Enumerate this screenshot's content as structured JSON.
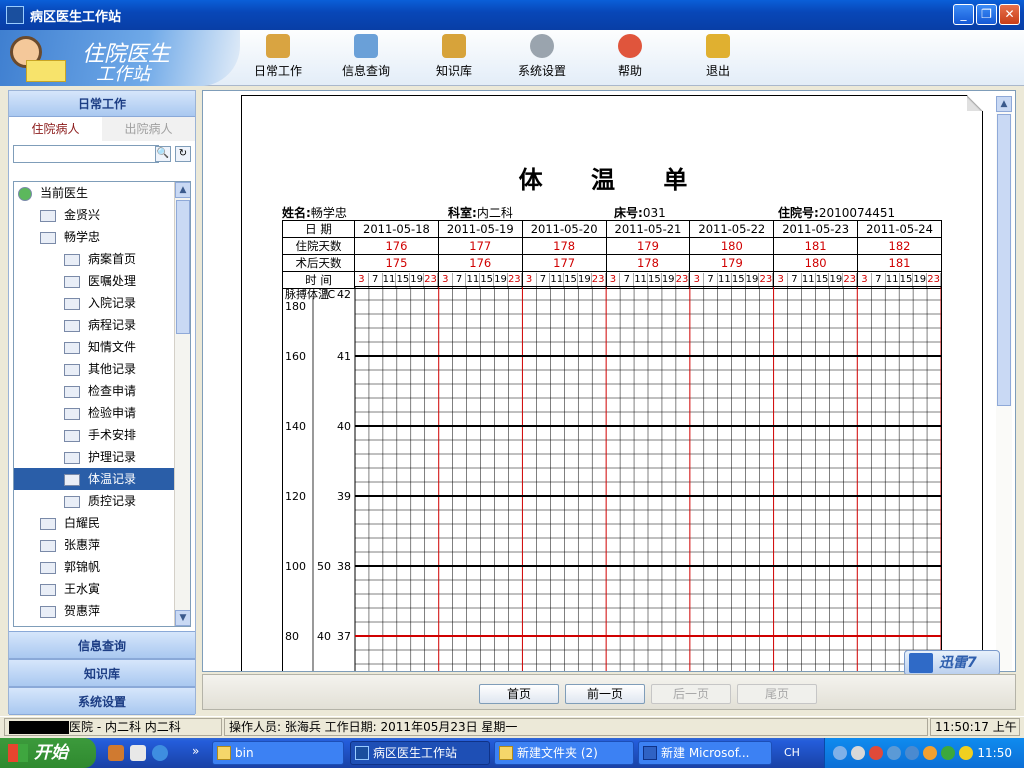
{
  "window": {
    "title": "病区医生工作站"
  },
  "logo": {
    "line1": "住院医生",
    "line2": "工作站"
  },
  "toolbar": [
    {
      "label": "日常工作",
      "icon": "clipboard-icon",
      "color": "#d9a441"
    },
    {
      "label": "信息查询",
      "icon": "search-doc-icon",
      "color": "#6aa0d8"
    },
    {
      "label": "知识库",
      "icon": "book-icon",
      "color": "#d7a33a"
    },
    {
      "label": "系统设置",
      "icon": "gear-icon",
      "color": "#9aa4ae"
    },
    {
      "label": "帮助",
      "icon": "lifebuoy-icon",
      "color": "#e0553c"
    },
    {
      "label": "退出",
      "icon": "exit-icon",
      "color": "#e0b030"
    }
  ],
  "sidebar": {
    "head": "日常工作",
    "tabs": [
      "住院病人",
      "出院病人"
    ],
    "search_value": "",
    "tree": [
      {
        "label": "当前医生",
        "level": 0,
        "icon": "plus-circle-icon"
      },
      {
        "label": "金贤兴",
        "level": 1,
        "icon": "patient-card-icon"
      },
      {
        "label": "畅学忠",
        "level": 1,
        "icon": "patient-card-icon"
      },
      {
        "label": "病案首页",
        "level": 2,
        "icon": "home-doc-icon"
      },
      {
        "label": "医嘱处理",
        "level": 2,
        "icon": "edit-doc-icon"
      },
      {
        "label": "入院记录",
        "level": 2,
        "icon": "admission-icon"
      },
      {
        "label": "病程记录",
        "level": 2,
        "icon": "progress-doc-icon"
      },
      {
        "label": "知情文件",
        "level": 2,
        "icon": "blank-doc-icon"
      },
      {
        "label": "其他记录",
        "level": 2,
        "icon": "list-doc-icon"
      },
      {
        "label": "检查申请",
        "level": 2,
        "icon": "exam-icon"
      },
      {
        "label": "检验申请",
        "level": 2,
        "icon": "lab-icon"
      },
      {
        "label": "手术安排",
        "level": 2,
        "icon": "clock-icon"
      },
      {
        "label": "护理记录",
        "level": 2,
        "icon": "nursing-icon"
      },
      {
        "label": "体温记录",
        "level": 2,
        "icon": "chart-doc-icon",
        "selected": true
      },
      {
        "label": "质控记录",
        "level": 2,
        "icon": "warning-doc-icon"
      },
      {
        "label": "白耀民",
        "level": 1,
        "icon": "patient-card-icon"
      },
      {
        "label": "张惠萍",
        "level": 1,
        "icon": "patient-card-icon"
      },
      {
        "label": "郭锦帆",
        "level": 1,
        "icon": "patient-card-icon"
      },
      {
        "label": "王水寅",
        "level": 1,
        "icon": "patient-card-icon"
      },
      {
        "label": "贺惠萍",
        "level": 1,
        "icon": "patient-card-icon"
      }
    ],
    "sections": [
      "信息查询",
      "知识库",
      "系统设置"
    ]
  },
  "sheet": {
    "title": "体 温 单",
    "name_label": "姓名:",
    "name": "畅学忠",
    "dept_label": "科室:",
    "dept": "内二科",
    "bed_label": "床号:",
    "bed": "031",
    "inpatient_label": "住院号:",
    "inpatient_no": "2010074451",
    "row_labels": {
      "date": "日  期",
      "hosp_days": "住院天数",
      "post_op_days": "术后天数",
      "time": "时  间"
    },
    "dates": [
      "2011-05-18",
      "2011-05-19",
      "2011-05-20",
      "2011-05-21",
      "2011-05-22",
      "2011-05-23",
      "2011-05-24"
    ],
    "hosp_days": [
      "176",
      "177",
      "178",
      "179",
      "180",
      "181",
      "182"
    ],
    "post_op_days": [
      "175",
      "176",
      "177",
      "178",
      "179",
      "180",
      "181"
    ],
    "times": [
      "3",
      "7",
      "11",
      "15",
      "19",
      "23"
    ],
    "axis": {
      "pulse_label": "脉搏",
      "temp_label": "体温",
      "temp_unit": "℃",
      "pulse_ticks": [
        "180",
        "160",
        "140",
        "120",
        "100",
        "80"
      ],
      "temp_ticks": [
        "42",
        "41",
        "40",
        "39",
        "38",
        "37"
      ],
      "resp_ticks": [
        "50",
        "40"
      ]
    }
  },
  "pager": {
    "first": "首页",
    "prev": "前一页",
    "next": "后一页",
    "last": "尾页"
  },
  "xunlei": {
    "label": "迅雷7"
  },
  "status": {
    "hospital": "医院 - 内二科 内二科",
    "operator": "操作人员: 张海兵  工作日期: 2011年05月23日 星期一",
    "time": "11:50:17 上午"
  },
  "taskbar": {
    "start": "开始",
    "tasks": [
      "bin",
      "病区医生工作站",
      "新建文件夹 (2)",
      "新建 Microsof..."
    ],
    "lang": "CH",
    "clock": "11:50"
  }
}
